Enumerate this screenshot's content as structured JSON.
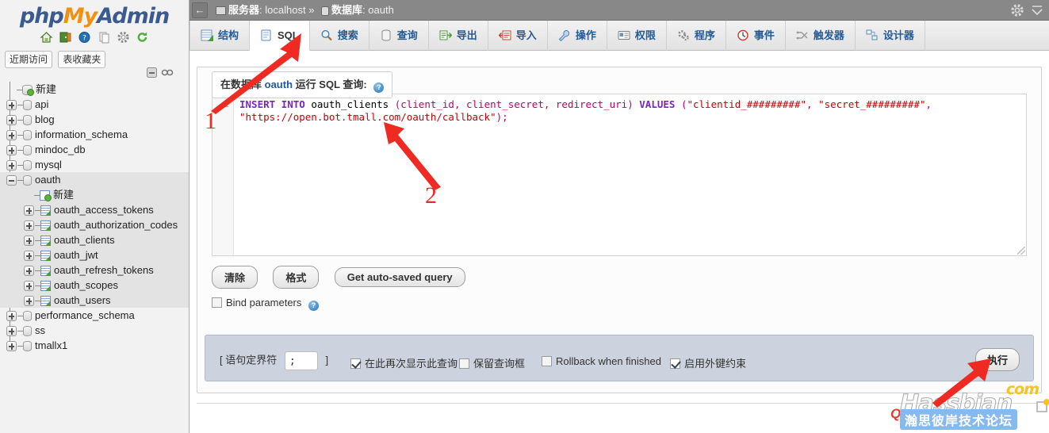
{
  "sidebar": {
    "logo": {
      "part1": "php",
      "part2": "My",
      "part3": "Admin"
    },
    "logo_icons": [
      "home-icon",
      "logout-icon",
      "docs-icon",
      "new-window-icon",
      "settings-icon",
      "reload-icon"
    ],
    "quicklinks": [
      {
        "label": "近期访问",
        "name": "recent-tables-button"
      },
      {
        "label": "表收藏夹",
        "name": "favorite-tables-button"
      }
    ],
    "panel_icons": [
      "collapse-panel-icon",
      "unlink-panel-icon"
    ],
    "tree": [
      {
        "label": "新建",
        "icon": "new-database-icon",
        "toggle": "none",
        "depth": 0,
        "selected": false
      },
      {
        "label": "api",
        "icon": "database-icon",
        "toggle": "plus",
        "depth": 0,
        "selected": false
      },
      {
        "label": "blog",
        "icon": "database-icon",
        "toggle": "plus",
        "depth": 0,
        "selected": false
      },
      {
        "label": "information_schema",
        "icon": "database-icon",
        "toggle": "plus",
        "depth": 0,
        "selected": false
      },
      {
        "label": "mindoc_db",
        "icon": "database-icon",
        "toggle": "plus",
        "depth": 0,
        "selected": false
      },
      {
        "label": "mysql",
        "icon": "database-icon",
        "toggle": "plus",
        "depth": 0,
        "selected": false
      },
      {
        "label": "oauth",
        "icon": "database-icon",
        "toggle": "minus",
        "depth": 0,
        "selected": true
      },
      {
        "label": "新建",
        "icon": "new-table-icon",
        "toggle": "none",
        "depth": 1,
        "selected": true
      },
      {
        "label": "oauth_access_tokens",
        "icon": "table-icon",
        "toggle": "plus",
        "depth": 1,
        "selected": true
      },
      {
        "label": "oauth_authorization_codes",
        "icon": "table-icon",
        "toggle": "plus",
        "depth": 1,
        "selected": true
      },
      {
        "label": "oauth_clients",
        "icon": "table-icon",
        "toggle": "plus",
        "depth": 1,
        "selected": true
      },
      {
        "label": "oauth_jwt",
        "icon": "table-icon",
        "toggle": "plus",
        "depth": 1,
        "selected": true
      },
      {
        "label": "oauth_refresh_tokens",
        "icon": "table-icon",
        "toggle": "plus",
        "depth": 1,
        "selected": true
      },
      {
        "label": "oauth_scopes",
        "icon": "table-icon",
        "toggle": "plus",
        "depth": 1,
        "selected": true
      },
      {
        "label": "oauth_users",
        "icon": "table-icon",
        "toggle": "plus",
        "depth": 1,
        "selected": true
      },
      {
        "label": "performance_schema",
        "icon": "database-icon",
        "toggle": "plus",
        "depth": 0,
        "selected": false
      },
      {
        "label": "ss",
        "icon": "database-icon",
        "toggle": "plus",
        "depth": 0,
        "selected": false
      },
      {
        "label": "tmallx1",
        "icon": "database-icon",
        "toggle": "plus",
        "depth": 0,
        "selected": false
      }
    ]
  },
  "topbar": {
    "back_label": "←",
    "server_label": "服务器",
    "server_value": "localhost",
    "separator": "»",
    "database_label": "数据库",
    "database_value": "oauth",
    "settings_icon": "gear-icon",
    "collapse_icon": "collapse-icon"
  },
  "tabs": [
    {
      "label": "结构",
      "icon": "structure-icon",
      "active": false
    },
    {
      "label": "SQL",
      "icon": "sql-icon",
      "active": true
    },
    {
      "label": "搜索",
      "icon": "search-icon",
      "active": false
    },
    {
      "label": "查询",
      "icon": "query-icon",
      "active": false
    },
    {
      "label": "导出",
      "icon": "export-icon",
      "active": false
    },
    {
      "label": "导入",
      "icon": "import-icon",
      "active": false
    },
    {
      "label": "操作",
      "icon": "operations-icon",
      "active": false
    },
    {
      "label": "权限",
      "icon": "privileges-icon",
      "active": false
    },
    {
      "label": "程序",
      "icon": "routines-icon",
      "active": false
    },
    {
      "label": "事件",
      "icon": "events-icon",
      "active": false
    },
    {
      "label": "触发器",
      "icon": "triggers-icon",
      "active": false
    },
    {
      "label": "设计器",
      "icon": "designer-icon",
      "active": false
    }
  ],
  "sql_panel": {
    "legend_prefix": "在数据库",
    "legend_db": "oauth",
    "legend_suffix": "运行 SQL 查询:",
    "help_icon": "help-icon",
    "line_number": "1",
    "query": {
      "keyword1": "INSERT INTO",
      "table": "oauth_clients",
      "columns": "(client_id, client_secret, redirect_uri)",
      "keyword2": "VALUES",
      "value1": "\"clientid_#########\"",
      "value2": "\"secret_#########\"",
      "value3": "\"https://open.bot.tmall.com/oauth/callback\"",
      "full_text": "INSERT INTO oauth_clients (client_id, client_secret, redirect_uri) VALUES (\"clientid_#########\", \"secret_#########\", \"https://open.bot.tmall.com/oauth/callback\");"
    },
    "buttons": [
      {
        "label": "清除",
        "name": "clear-button"
      },
      {
        "label": "格式",
        "name": "format-button"
      },
      {
        "label": "Get auto-saved query",
        "name": "get-auto-saved-query-button"
      }
    ],
    "bind_parameters": {
      "label": "Bind parameters",
      "checked": false,
      "help_icon": "help-icon"
    }
  },
  "footer": {
    "delimiter_open_bracket": "[",
    "delimiter_label": "语句定界符",
    "delimiter_value": ";",
    "delimiter_close_bracket": "]",
    "options": [
      {
        "label": "在此再次显示此查询",
        "checked": true,
        "name": "show-query-again-checkbox"
      },
      {
        "label": "保留查询框",
        "checked": false,
        "name": "retain-query-box-checkbox"
      },
      {
        "label": "Rollback when finished",
        "checked": false,
        "name": "rollback-when-finished-checkbox"
      },
      {
        "label": "启用外键约束",
        "checked": true,
        "name": "enable-foreign-key-checks-checkbox"
      }
    ],
    "go_label": "执行"
  },
  "annotations": [
    {
      "number": "1",
      "target": "sql-tab"
    },
    {
      "number": "2",
      "target": "sql-editor"
    }
  ],
  "watermark": {
    "com": "com",
    "brand": "Hassbian",
    "chinese": "瀚思彼岸技术论坛"
  },
  "colors": {
    "brand_blue": "#3b5a8f",
    "brand_orange": "#f29111",
    "tab_link": "#235a97",
    "annotation_red": "#ef2a23",
    "footer_bg": "#ccd3de",
    "watermark_blue": "#86b9ef",
    "watermark_yellow": "#f6c324"
  }
}
